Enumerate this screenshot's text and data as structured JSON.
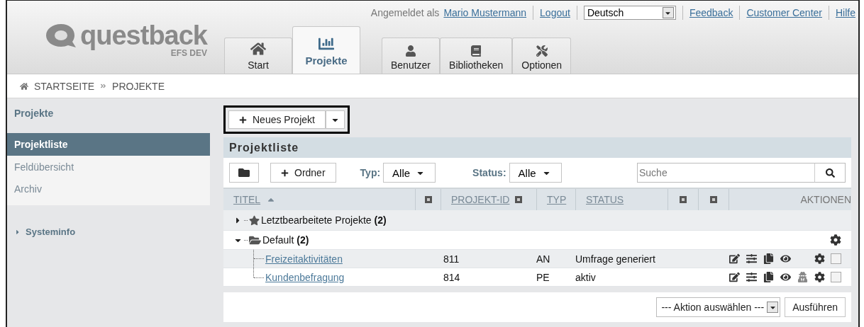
{
  "top_links": {
    "logged_in_label": "Angemeldet als",
    "user": "Mario Mustermann",
    "logout": "Logout",
    "language": "Deutsch",
    "links": [
      "Feedback",
      "Customer Center",
      "Hilfe"
    ]
  },
  "logo": {
    "name": "questback",
    "subtitle": "EFS DEV"
  },
  "main_tabs": [
    {
      "label": "Start",
      "kind": "home",
      "selected": false
    },
    {
      "label": "Projekte",
      "kind": "chart",
      "selected": true
    }
  ],
  "admin_tabs": [
    {
      "label": "Benutzer",
      "kind": "user",
      "selected": false
    },
    {
      "label": "Bibliotheken",
      "kind": "book",
      "selected": false
    },
    {
      "label": "Optionen",
      "kind": "tools",
      "selected": false
    }
  ],
  "breadcrumb": [
    "STARTSEITE",
    "PROJEKTE"
  ],
  "sidebar": {
    "title": "Projekte",
    "items": [
      {
        "label": "Projektliste",
        "selected": true
      },
      {
        "label": "Feldübersicht",
        "selected": false
      },
      {
        "label": "Archiv",
        "selected": false
      }
    ],
    "section": {
      "label": "Systeminfo",
      "expanded": false
    }
  },
  "new_project_button": "Neues Projekt",
  "panel": {
    "title": "Projektliste",
    "new_folder_button": "Ordner",
    "filters": [
      {
        "label": "Typ:",
        "value": "Alle"
      },
      {
        "label": "Status:",
        "value": "Alle"
      }
    ],
    "search": {
      "placeholder": "Suche"
    },
    "columns": [
      {
        "label": "TITEL",
        "kind": "link",
        "sort_ascending": true
      },
      {
        "kind": "toggle"
      },
      {
        "label": "PROJEKT-ID",
        "kind": "link-toggle"
      },
      {
        "label": "TYP",
        "kind": "link"
      },
      {
        "label": "STATUS",
        "kind": "link"
      },
      {
        "kind": "toggle"
      },
      {
        "kind": "toggle"
      },
      {
        "label": "AKTIONEN",
        "kind": "plain"
      }
    ],
    "tree": [
      {
        "name": "Letztbearbeitete Projekte",
        "count": "(2)",
        "kind": "recent",
        "expanded": false
      },
      {
        "name": "Default",
        "count": "(2)",
        "kind": "folder",
        "expanded": true,
        "actions": [
          {
            "kind": "settings"
          }
        ],
        "children": [
          {
            "title": "Freizeitaktivitäten",
            "id": "811",
            "type": "AN",
            "status": "Umfrage generiert",
            "actions": [
              {
                "kind": "edit"
              },
              {
                "kind": "mixer"
              },
              {
                "kind": "copy"
              },
              {
                "kind": "view"
              },
              {
                "kind": "settings"
              }
            ],
            "checked": false
          },
          {
            "title": "Kundenbefragung",
            "id": "814",
            "type": "PE",
            "status": "aktiv",
            "actions": [
              {
                "kind": "edit"
              },
              {
                "kind": "mixer"
              },
              {
                "kind": "copy"
              },
              {
                "kind": "view"
              },
              {
                "kind": "person"
              },
              {
                "kind": "settings"
              }
            ],
            "checked": false
          }
        ]
      }
    ],
    "footer": {
      "action_select": "--- Aktion auswählen ---",
      "run_button": "Ausführen"
    }
  }
}
